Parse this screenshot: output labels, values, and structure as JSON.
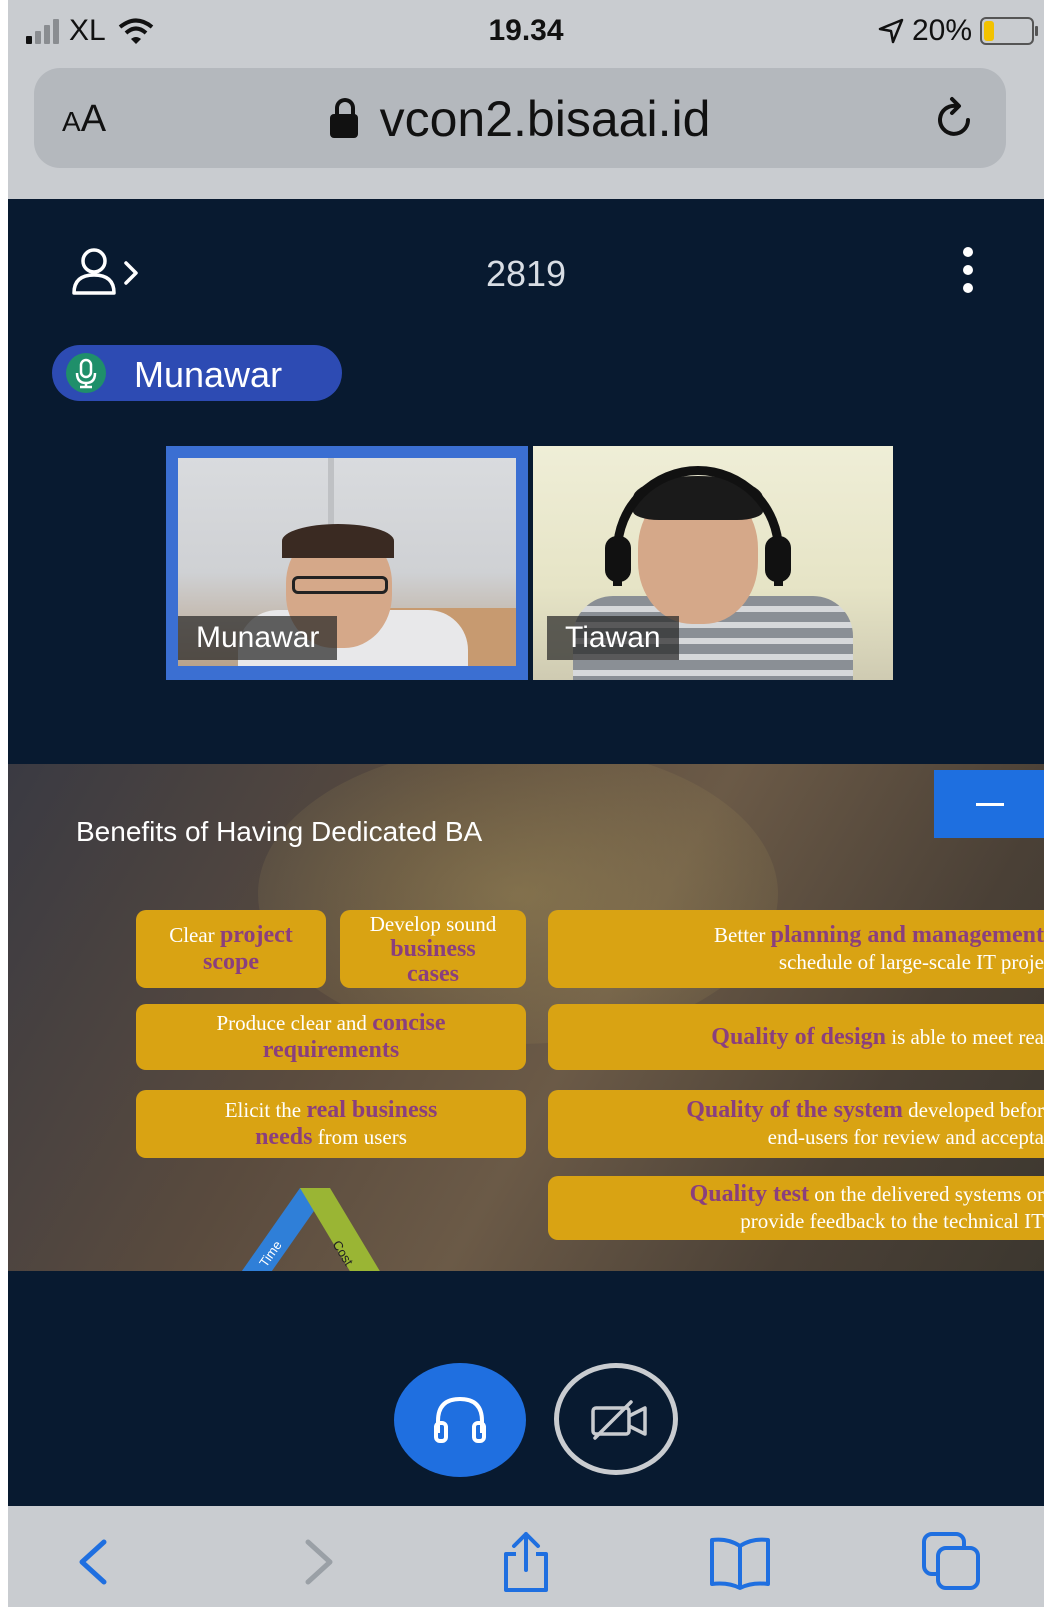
{
  "status_bar": {
    "carrier": "XL",
    "time": "19.34",
    "battery": "20%",
    "battery_level": 0.2
  },
  "browser": {
    "text_size_label": "AA",
    "url": "vcon2.bisaai.id"
  },
  "conference": {
    "room_id": "2819",
    "active_speaker": "Munawar",
    "participants": [
      {
        "name": "Munawar"
      },
      {
        "name": "Tiawan"
      }
    ]
  },
  "slide": {
    "title": "Benefits of Having Dedicated BA",
    "boxes": [
      {
        "pre": "Clear ",
        "hl": "project",
        "post": "",
        "line2_hl": "scope",
        "line2": ""
      },
      {
        "l1": "Develop sound",
        "l2_hl": "business",
        "l3_hl": "cases"
      },
      {
        "l1": "Better ",
        "l1_hl": "planning and management",
        "l2": "schedule of large-scale IT proje"
      },
      {
        "l1": "Produce clear and ",
        "l1_hl": "concise",
        "l2_hl": "requirements"
      },
      {
        "l1_hl": "Quality of design",
        "l1": "  is able to meet rea"
      },
      {
        "l1": "Elicit the ",
        "l1_hl": "real business",
        "l2_hl": "needs",
        "l2": " from users"
      },
      {
        "l1_hl": "Quality of the system",
        "l1": " developed befor",
        "l2": "end-users for review and accepta"
      },
      {
        "l1_hl": "Quality test",
        "l1": " on the delivered systems or",
        "l2": "provide feedback to the technical IT"
      }
    ],
    "triangle_labels": [
      "Time",
      "Cost"
    ]
  },
  "controls": {
    "audio": "headphones-icon",
    "video": "video-off-icon"
  },
  "colors": {
    "accent_blue": "#1f6fe0",
    "speaker_pill": "#2d4bb3",
    "background": "#081a30",
    "slide_box": "#d9a313",
    "slide_highlight": "#8a3f7e"
  }
}
